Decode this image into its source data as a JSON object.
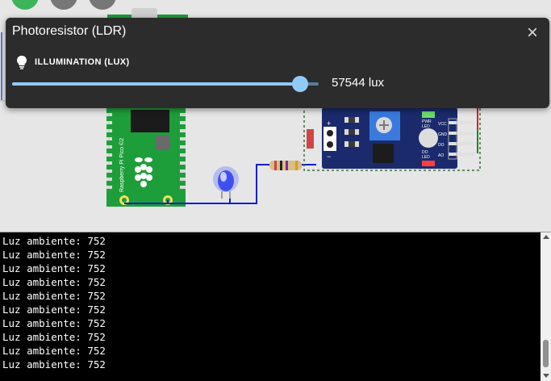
{
  "popup": {
    "title": "Photoresistor (LDR)",
    "close_icon": "close-icon",
    "illumination_label": "ILLUMINATION (LUX)",
    "illumination_icon": "lightbulb-icon",
    "value": 57544,
    "value_text": "57544 lux",
    "slider_fraction": 0.94
  },
  "board": {
    "label": "Raspberry Pi Pico ©2"
  },
  "sensor_module": {
    "labels": [
      "PWR LED",
      "VCC",
      "GND",
      "DO",
      "AO",
      "DO LED"
    ]
  },
  "serial": {
    "lines": [
      "Luz ambiente: 752",
      "Luz ambiente: 752",
      "Luz ambiente: 752",
      "Luz ambiente: 752",
      "Luz ambiente: 752",
      "Luz ambiente: 752",
      "Luz ambiente: 752",
      "Luz ambiente: 752",
      "Luz ambiente: 752",
      "Luz ambiente: 752"
    ]
  },
  "colors": {
    "popup_bg": "#2c2c2c",
    "slider_accent": "#90caf9",
    "wire": "#0a1fd0",
    "pcb_green": "#1e9e3a",
    "module_blue": "#1a2a6c"
  }
}
